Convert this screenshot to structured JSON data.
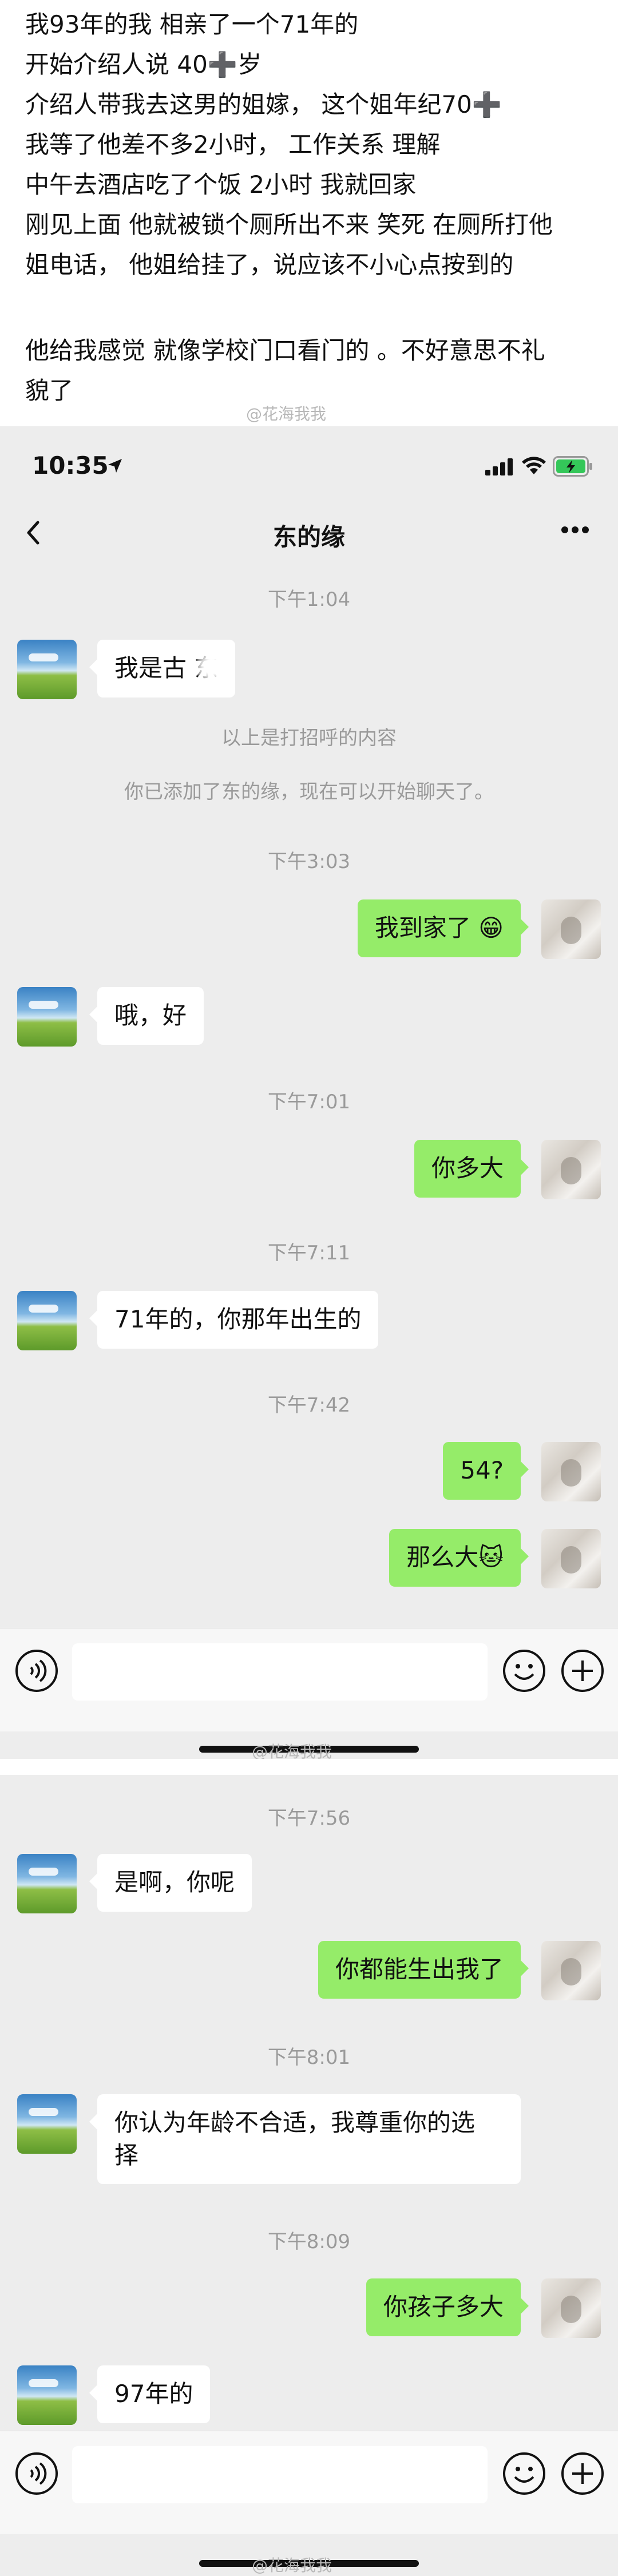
{
  "story": {
    "lines": [
      "我93年的我 相亲了一个71年的",
      "开始介绍人说 40➕岁",
      "介绍人带我去这男的姐嫁， 这个姐年纪70➕",
      "我等了他差不多2小时， 工作关系 理解",
      "中午去酒店吃了个饭 2小时 我就回家",
      "刚见上面 他就被锁个厕所出不来 笑死 在厕所打他",
      "姐电话， 他姐给挂了，说应该不小心点按到的",
      "",
      "他给我感觉 就像学校门口看门的 。不好意思不礼",
      "貌了"
    ]
  },
  "status_bar": {
    "time": "10:35"
  },
  "chat": {
    "title": "东的缘",
    "messages_1": {
      "ts1": "下午1:04",
      "m1": "我是古  东",
      "sys1": "以上是打招呼的内容",
      "sys2": "你已添加了东的缘，现在可以开始聊天了。",
      "ts2": "下午3:03",
      "m2": "我到家了 😁",
      "m3": "哦，好",
      "ts3": "下午7:01",
      "m4": "你多大",
      "ts4": "下午7:11",
      "m5": "71年的，你那年出生的",
      "ts5": "下午7:42",
      "m6": "54?",
      "m7": "那么大🐱"
    },
    "messages_2": {
      "ts1": "下午7:56",
      "m1": "是啊，你呢",
      "m2": "你都能生出我了",
      "ts2": "下午8:01",
      "m3_l1": "你认为年龄不合适，我尊重你的选",
      "m3_l2": "择",
      "ts3": "下午8:09",
      "m4": "你孩子多大",
      "m5": "97年的"
    }
  },
  "watermarks": {
    "w1": "@花海我我",
    "w2": "@花海我我",
    "w3": "@花海我我"
  },
  "colors": {
    "outgoing_bubble": "#95ec69",
    "incoming_bubble": "#ffffff",
    "chat_bg": "#ededed"
  }
}
